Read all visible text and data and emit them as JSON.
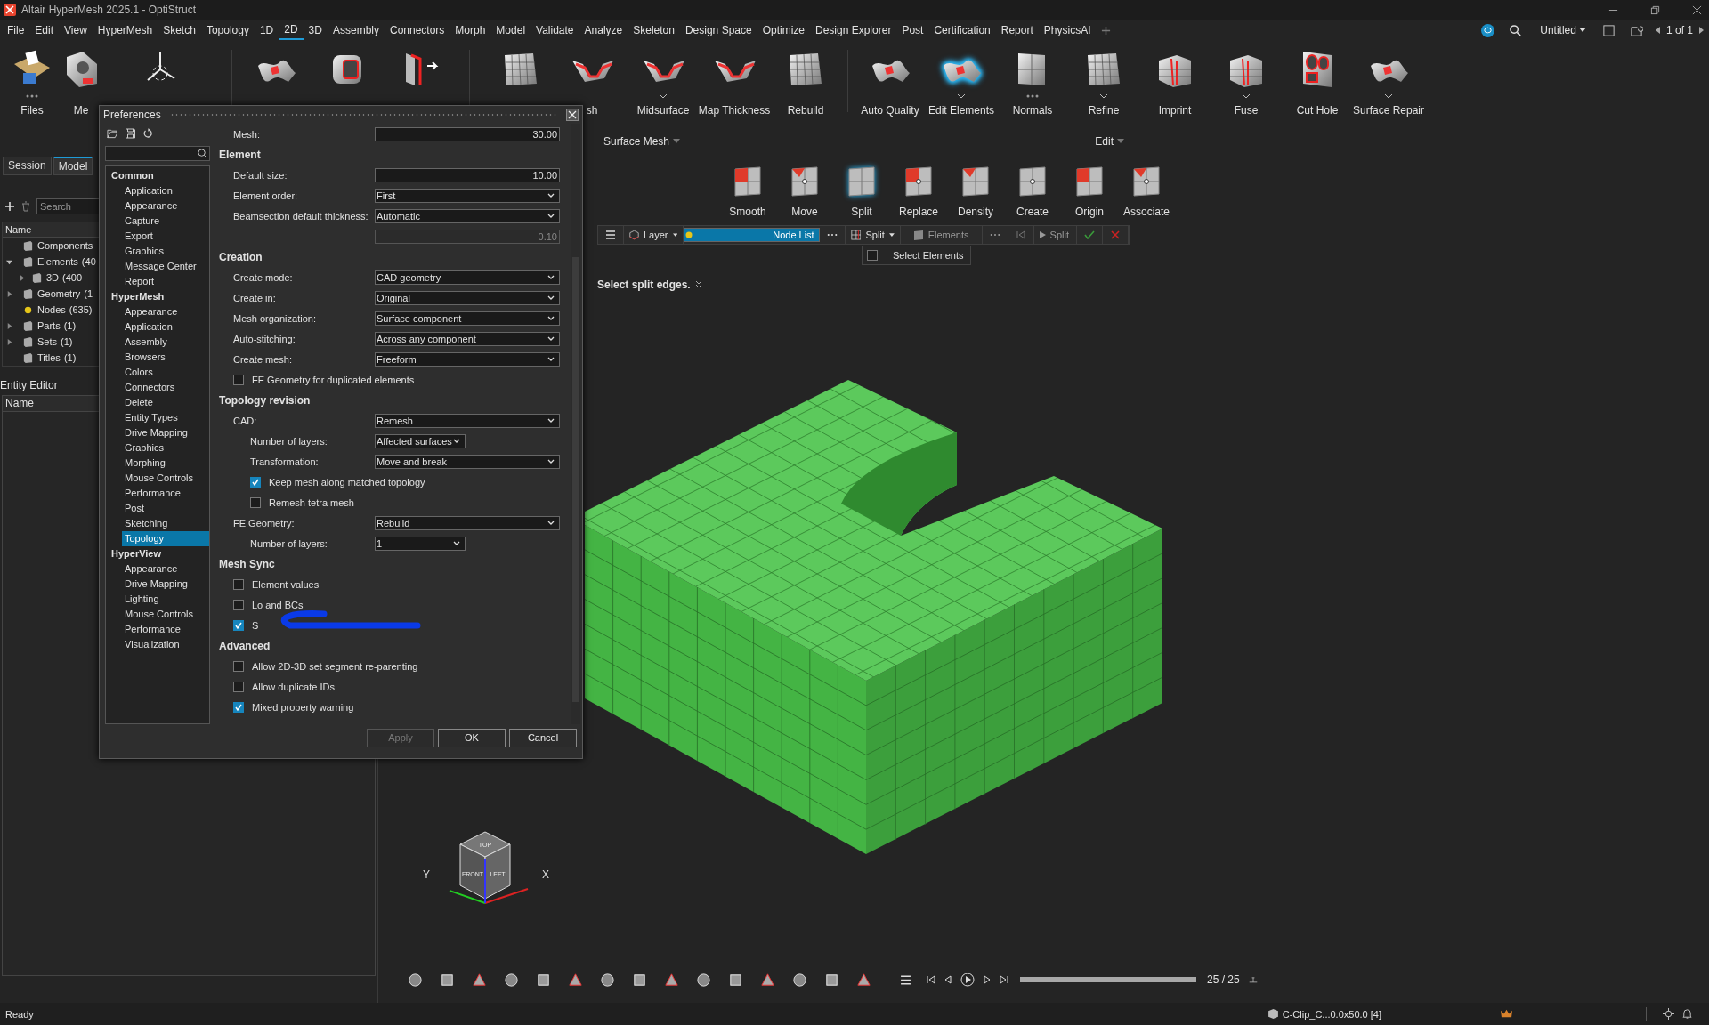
{
  "window": {
    "title": "Altair HyperMesh 2025.1 - OptiStruct"
  },
  "menu": [
    {
      "label": "File",
      "selected": false
    },
    {
      "label": "Edit",
      "selected": false
    },
    {
      "label": "View",
      "selected": false
    },
    {
      "label": "HyperMesh",
      "selected": false
    },
    {
      "label": "Sketch",
      "selected": false
    },
    {
      "label": "Topology",
      "selected": false
    },
    {
      "label": "1D",
      "selected": false
    },
    {
      "label": "2D",
      "selected": true
    },
    {
      "label": "3D",
      "selected": false
    },
    {
      "label": "Assembly",
      "selected": false
    },
    {
      "label": "Connectors",
      "selected": false
    },
    {
      "label": "Morph",
      "selected": false
    },
    {
      "label": "Model",
      "selected": false
    },
    {
      "label": "Validate",
      "selected": false
    },
    {
      "label": "Analyze",
      "selected": false
    },
    {
      "label": "Skeleton",
      "selected": false
    },
    {
      "label": "Design Space",
      "selected": false
    },
    {
      "label": "Optimize",
      "selected": false
    },
    {
      "label": "Design Explorer",
      "selected": false
    },
    {
      "label": "Post",
      "selected": false
    },
    {
      "label": "Certification",
      "selected": false
    },
    {
      "label": "Report",
      "selected": false
    },
    {
      "label": "PhysicsAI",
      "selected": false
    }
  ],
  "top_right": {
    "document": "Untitled",
    "page": "1 of 1"
  },
  "ribbon": {
    "items": [
      {
        "label": "Files",
        "selected": false,
        "kind": "more"
      },
      {
        "label": "Me",
        "selected": false,
        "kind": "plain"
      },
      {
        "selected": false,
        "kind": "plain"
      },
      {
        "selected": false,
        "kind": "plain"
      },
      {
        "selected": false,
        "kind": "plain"
      },
      {
        "selected": false,
        "kind": "plain"
      },
      {
        "selected": false,
        "kind": "plain"
      },
      {
        "label": "sh",
        "selected": false,
        "kind": "plain"
      },
      {
        "label": "Midsurface",
        "selected": false,
        "kind": "dropdown"
      },
      {
        "label": "Map Thickness",
        "selected": false,
        "kind": "plain"
      },
      {
        "label": "Rebuild",
        "selected": false,
        "kind": "plain"
      },
      {
        "label": "Auto Quality",
        "selected": false,
        "kind": "plain"
      },
      {
        "label": "Edit Elements",
        "selected": true,
        "kind": "dropdown"
      },
      {
        "label": "Normals",
        "selected": false,
        "kind": "more"
      },
      {
        "label": "Refine",
        "selected": false,
        "kind": "dropdown"
      },
      {
        "label": "Imprint",
        "selected": false,
        "kind": "plain"
      },
      {
        "label": "Fuse",
        "selected": false,
        "kind": "dropdown"
      },
      {
        "label": "Cut Hole",
        "selected": false,
        "kind": "plain"
      },
      {
        "label": "Surface Repair",
        "selected": false,
        "kind": "dropdown"
      }
    ],
    "groups": [
      "Surface Mesh",
      "Edit"
    ]
  },
  "tools": [
    {
      "label": "Smooth",
      "selected": false
    },
    {
      "label": "Move",
      "selected": false
    },
    {
      "label": "Split",
      "selected": true
    },
    {
      "label": "Replace",
      "selected": false
    },
    {
      "label": "Density",
      "selected": false
    },
    {
      "label": "Create",
      "selected": false
    },
    {
      "label": "Origin",
      "selected": false
    },
    {
      "label": "Associate",
      "selected": false
    }
  ],
  "context_bar": {
    "layer": "Layer",
    "collectors": [
      {
        "label": "Node List",
        "selected": true
      },
      {
        "label": "Elements",
        "selected": false
      }
    ],
    "mode": "Split",
    "run": "Split",
    "popup": {
      "label": "Select Elements",
      "checked": false
    }
  },
  "hint": "Select split edges.",
  "left_panel": {
    "tabs": [
      {
        "label": "Session",
        "selected": false
      },
      {
        "label": "Model",
        "selected": true
      }
    ],
    "search": {
      "placeholder": "Search"
    },
    "column": "Name",
    "tree": [
      {
        "label": "Components"
      },
      {
        "label": "Elements",
        "count": "(40",
        "expanded": true,
        "children": [
          {
            "label": "3D",
            "count": "(400",
            "expanded": false
          }
        ]
      },
      {
        "label": "Geometry",
        "count": "(1",
        "expanded": false
      },
      {
        "label": "Nodes",
        "count": "(635)"
      },
      {
        "label": "Parts",
        "count": "(1)",
        "expanded": false
      },
      {
        "label": "Sets",
        "count": "(1)",
        "expanded": false
      },
      {
        "label": "Titles",
        "count": "(1)"
      }
    ],
    "editor_title": "Entity Editor",
    "editor_column": "Name"
  },
  "view_cube": {
    "faces": [
      "TOP",
      "FRONT",
      "LEFT"
    ],
    "axes": [
      "Y",
      "X"
    ]
  },
  "playback": {
    "level": 1,
    "frame": "25 / 25"
  },
  "status_bar": {
    "text": "Ready",
    "model": "C-Clip_C...0.0x50.0 [4]"
  },
  "dialog": {
    "title": "Preferences",
    "categories": [
      {
        "label": "Common",
        "children": [
          {
            "label": "Application",
            "selected": false
          },
          {
            "label": "Appearance",
            "selected": false
          },
          {
            "label": "Capture",
            "selected": false
          },
          {
            "label": "Export",
            "selected": false
          },
          {
            "label": "Graphics",
            "selected": false
          },
          {
            "label": "Message Center",
            "selected": false
          },
          {
            "label": "Report",
            "selected": false
          }
        ]
      },
      {
        "label": "HyperMesh",
        "children": [
          {
            "label": "Appearance",
            "selected": false
          },
          {
            "label": "Application",
            "selected": false
          },
          {
            "label": "Assembly",
            "selected": false
          },
          {
            "label": "Browsers",
            "selected": false
          },
          {
            "label": "Colors",
            "selected": false
          },
          {
            "label": "Connectors",
            "selected": false
          },
          {
            "label": "Delete",
            "selected": false
          },
          {
            "label": "Entity Types",
            "selected": false
          },
          {
            "label": "Drive Mapping",
            "selected": false
          },
          {
            "label": "Graphics",
            "selected": false
          },
          {
            "label": "Morphing",
            "selected": false
          },
          {
            "label": "Mouse Controls",
            "selected": false
          },
          {
            "label": "Performance",
            "selected": false
          },
          {
            "label": "Post",
            "selected": false
          },
          {
            "label": "Sketching",
            "selected": false
          },
          {
            "label": "Topology",
            "selected": true
          }
        ]
      },
      {
        "label": "HyperView",
        "children": [
          {
            "label": "Appearance",
            "selected": false
          },
          {
            "label": "Drive Mapping",
            "selected": false
          },
          {
            "label": "Lighting",
            "selected": false
          },
          {
            "label": "Mouse Controls",
            "selected": false
          },
          {
            "label": "Performance",
            "selected": false
          },
          {
            "label": "Visualization",
            "selected": false
          }
        ]
      }
    ],
    "form": [
      {
        "kind": "field",
        "label": "Mesh:",
        "value": "30.00",
        "disabled": false
      },
      {
        "kind": "heading",
        "label": "Element"
      },
      {
        "kind": "field",
        "label": "Default size:",
        "value": "10.00",
        "disabled": false
      },
      {
        "kind": "select",
        "label": "Element order:",
        "value": "First"
      },
      {
        "kind": "select",
        "label": "Beamsection default thickness:",
        "value": "Automatic"
      },
      {
        "kind": "field",
        "value": "0.10",
        "disabled": true
      },
      {
        "kind": "heading",
        "label": "Creation"
      },
      {
        "kind": "select",
        "label": "Create mode:",
        "value": "CAD geometry"
      },
      {
        "kind": "select",
        "label": "Create in:",
        "value": "Original"
      },
      {
        "kind": "select",
        "label": "Mesh organization:",
        "value": "Surface component"
      },
      {
        "kind": "select",
        "label": "Auto-stitching:",
        "value": "Across any component"
      },
      {
        "kind": "select",
        "label": "Create mesh:",
        "value": "Freeform"
      },
      {
        "kind": "checkbox",
        "label": "FE Geometry for duplicated elements",
        "checked": false
      },
      {
        "kind": "heading",
        "label": "Topology revision"
      },
      {
        "kind": "select",
        "label": "CAD:",
        "value": "Remesh"
      },
      {
        "kind": "combo",
        "label": "Number of layers:",
        "value": "Affected surfaces",
        "indent": true
      },
      {
        "kind": "select",
        "label": "Transformation:",
        "value": "Move and break",
        "indent": true
      },
      {
        "kind": "checkbox",
        "label": "Keep mesh along matched topology",
        "checked": true,
        "indent": true
      },
      {
        "kind": "checkbox",
        "label": "Remesh tetra mesh",
        "checked": false,
        "indent": true
      },
      {
        "kind": "select",
        "label": "FE Geometry:",
        "value": "Rebuild"
      },
      {
        "kind": "combo",
        "label": "Number of layers:",
        "value": "1",
        "indent": true
      },
      {
        "kind": "heading",
        "label": "Mesh Sync"
      },
      {
        "kind": "checkbox",
        "label": "Element values",
        "checked": false
      },
      {
        "kind": "checkbox",
        "label": "Lo and BCs",
        "checked": false
      },
      {
        "kind": "checkbox",
        "label": "S",
        "checked": true
      },
      {
        "kind": "heading",
        "label": "Advanced"
      },
      {
        "kind": "checkbox",
        "label": "Allow 2D-3D set segment re-parenting",
        "checked": false
      },
      {
        "kind": "checkbox",
        "label": "Allow duplicate IDs",
        "checked": false
      },
      {
        "kind": "checkbox",
        "label": "Mixed property warning",
        "checked": true
      }
    ],
    "buttons": [
      {
        "label": "Apply",
        "disabled": true
      },
      {
        "label": "OK",
        "disabled": false
      },
      {
        "label": "Cancel",
        "disabled": false
      }
    ]
  }
}
